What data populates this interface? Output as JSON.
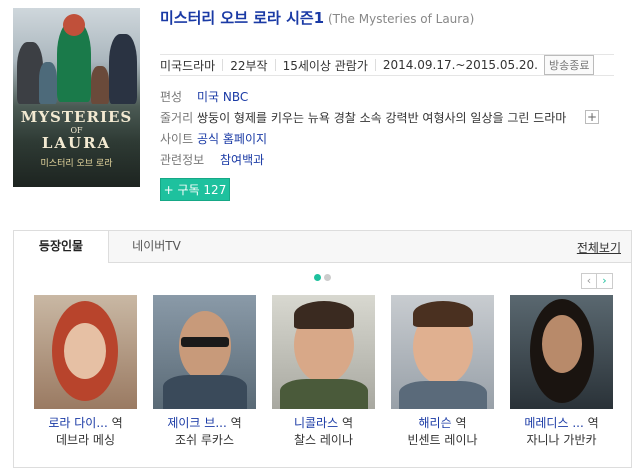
{
  "poster": {
    "title_line1": "MYSTERIES",
    "title_line2": "OF",
    "title_line3": "LAURA",
    "subtitle": "미스터리 오브 로라"
  },
  "title": {
    "main": "미스터리 오브 로라 시즌1",
    "eng": "(The Mysteries of Laura)"
  },
  "meta": {
    "genre": "미국드라마",
    "episodes": "22부작",
    "rating": "15세이상 관람가",
    "dates": "2014.09.17.~2015.05.20.",
    "status": "방송종료"
  },
  "info": {
    "network_label": "편성",
    "network_value": "미국 NBC",
    "synopsis_label": "줄거리",
    "synopsis_value": "쌍둥이 형제를 키우는 뉴욕 경찰 소속 강력반 여형사의 일상을 그린 드라마",
    "site_label": "사이트",
    "site_value": "공식 홈페이지",
    "related_label": "관련정보",
    "related_value": "참여백과",
    "more_symbol": "+"
  },
  "subscribe": {
    "label": "+ 구독 127"
  },
  "tabs": [
    {
      "label": "등장인물"
    },
    {
      "label": "네이버TV"
    }
  ],
  "view_all": "전체보기",
  "pager": {
    "prev": "‹",
    "next": "›"
  },
  "cast": [
    {
      "role": "로라 다이...",
      "suffix": "역",
      "actor": "데브라 메싱"
    },
    {
      "role": "제이크 브...",
      "suffix": "역",
      "actor": "조쉬 루카스"
    },
    {
      "role": "니콜라스",
      "suffix": "역",
      "actor": "찰스 레이나"
    },
    {
      "role": "해리슨",
      "suffix": "역",
      "actor": "빈센트 레이나"
    },
    {
      "role": "메레디스 ...",
      "suffix": "역",
      "actor": "자니나 가반카"
    }
  ],
  "colors": {
    "accent": "#1ec19e",
    "link": "#1a3aa5"
  }
}
